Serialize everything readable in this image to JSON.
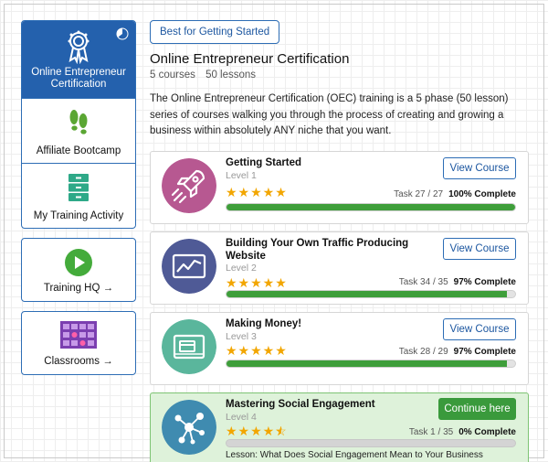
{
  "sidebar": {
    "items": [
      {
        "label": "Online Entrepreneur Certification",
        "icon": "award-ribbon-icon",
        "active": true
      },
      {
        "label": "Affiliate Bootcamp",
        "icon": "footprints-icon"
      },
      {
        "label": "My Training Activity",
        "icon": "filing-cabinet-icon"
      }
    ],
    "training_hq": {
      "label": "Training HQ →",
      "icon": "play-circle-icon"
    },
    "classrooms": {
      "label": "Classrooms →",
      "icon": "classroom-grid-icon"
    }
  },
  "header": {
    "tag_button": "Best for Getting Started",
    "title": "Online Entrepreneur Certification",
    "courses": "5 courses",
    "lessons": "50 lessons",
    "description": "The Online Entrepreneur Certification (OEC) training is a 5 phase (50 lesson) series of courses walking you through the process of creating and growing a business within absolutely ANY niche that you want."
  },
  "courses": [
    {
      "name": "Getting Started",
      "level": "Level 1",
      "task": "Task 27 / 27",
      "pct": "100% Complete",
      "progress": 1.0,
      "rating": 5,
      "button": "View Course",
      "icon": "rocket-icon",
      "color": "#b75891"
    },
    {
      "name": "Building Your Own Traffic Producing Website",
      "level": "Level 2",
      "task": "Task 34 / 35",
      "pct": "97% Complete",
      "progress": 0.97,
      "rating": 5,
      "button": "View Course",
      "icon": "chart-trend-icon",
      "color": "#4f5a96"
    },
    {
      "name": "Making Money!",
      "level": "Level 3",
      "task": "Task 28 / 29",
      "pct": "97% Complete",
      "progress": 0.97,
      "rating": 5,
      "button": "View Course",
      "icon": "money-cards-icon",
      "color": "#5ab69c"
    },
    {
      "name": "Mastering Social Engagement",
      "level": "Level 4",
      "task": "Task 1 / 35",
      "pct": "0% Complete",
      "progress": 0.0,
      "rating": 4.5,
      "button": "Continue here",
      "icon": "social-network-icon",
      "color": "#3f8bb0",
      "lesson": "Lesson: What Does Social Engagement Mean to Your Business"
    }
  ],
  "colors": {
    "accent": "#2461ad",
    "progress": "#3e9e3a",
    "star": "#f2a600",
    "current_bg": "#def2da"
  }
}
